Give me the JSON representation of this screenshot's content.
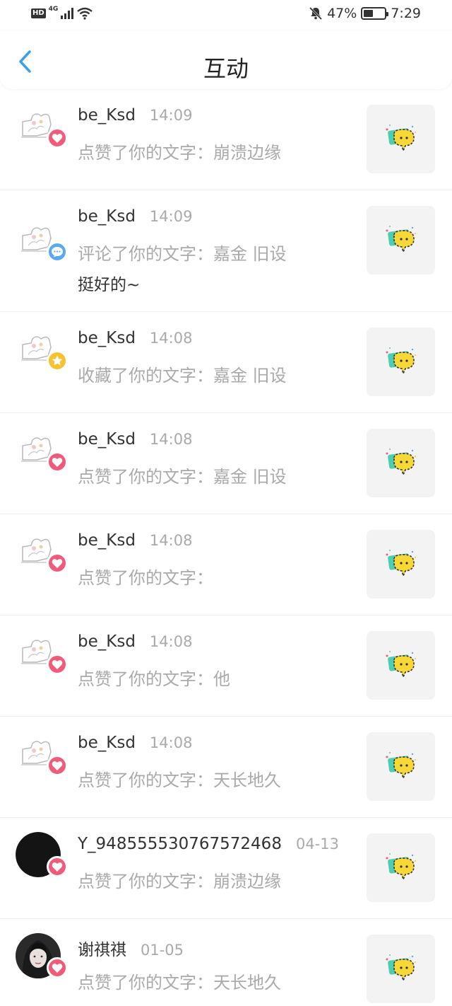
{
  "status_bar": {
    "hd": "HD",
    "network": "4G",
    "battery": "47%",
    "battery_level": 0.47,
    "time": "7:29"
  },
  "header": {
    "title": "互动"
  },
  "colors": {
    "like": "#f25a7a",
    "comment": "#5aa8f2",
    "favorite": "#f5c230",
    "back_arrow": "#3aa0e8"
  },
  "items": [
    {
      "user": "be_Ksd",
      "time": "14:09",
      "action": "点赞了你的文字：崩溃边缘",
      "badge": "like",
      "avatar": "sketch"
    },
    {
      "user": "be_Ksd",
      "time": "14:09",
      "action": "评论了你的文字：嘉金  旧设",
      "comment": "挺好的~",
      "badge": "comment",
      "avatar": "sketch"
    },
    {
      "user": "be_Ksd",
      "time": "14:08",
      "action": "收藏了你的文字：嘉金  旧设",
      "badge": "favorite",
      "avatar": "sketch"
    },
    {
      "user": "be_Ksd",
      "time": "14:08",
      "action": "点赞了你的文字：嘉金  旧设",
      "badge": "like",
      "avatar": "sketch"
    },
    {
      "user": "be_Ksd",
      "time": "14:08",
      "action": "点赞了你的文字：",
      "badge": "like",
      "avatar": "sketch"
    },
    {
      "user": "be_Ksd",
      "time": "14:08",
      "action": "点赞了你的文字：他",
      "badge": "like",
      "avatar": "sketch"
    },
    {
      "user": "be_Ksd",
      "time": "14:08",
      "action": "点赞了你的文字：天长地久",
      "badge": "like",
      "avatar": "sketch"
    },
    {
      "user": "Y_948555530767572468",
      "time": "04-13",
      "action": "点赞了你的文字：崩溃边缘",
      "badge": "like",
      "avatar": "black"
    },
    {
      "user": "谢祺祺",
      "time": "01-05",
      "action": "点赞了你的文字：天长地久",
      "badge": "like",
      "avatar": "photo"
    }
  ]
}
